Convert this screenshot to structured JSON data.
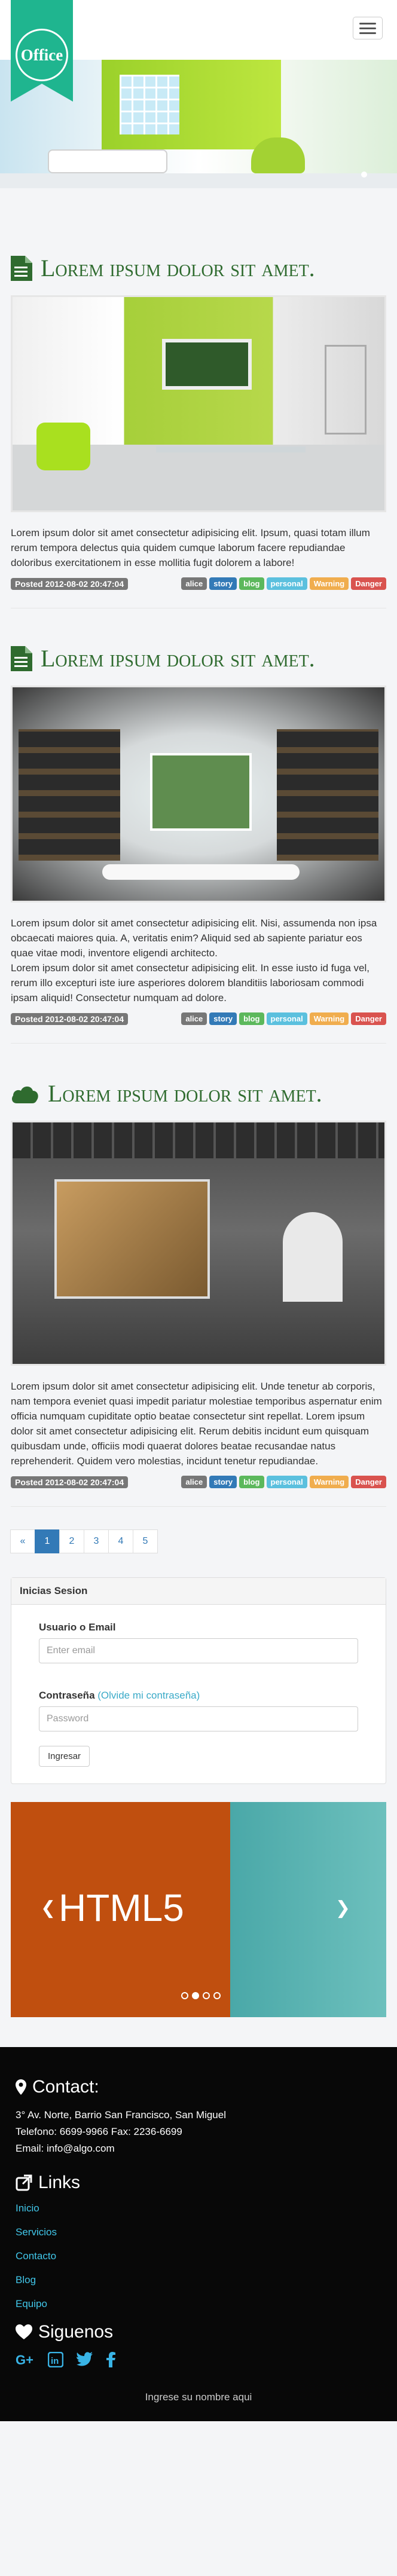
{
  "header": {
    "logo": "Office",
    "menu_icon": "hamburger-icon"
  },
  "posts": [
    {
      "title": "Lorem ipsum dolor sit amet.",
      "icon": "document-icon",
      "text": "Lorem ipsum dolor sit amet consectetur adipisicing elit. Ipsum, quasi totam illum rerum tempora delectus quia quidem cumque laborum facere repudiandae doloribus exercitationem in esse mollitia fugit dolorem a labore!",
      "date": "Posted 2012-08-02 20:47:04"
    },
    {
      "title": "Lorem ipsum dolor sit amet.",
      "icon": "document-icon",
      "text": "Lorem ipsum dolor sit amet consectetur adipisicing elit. Nisi, assumenda non ipsa obcaecati maiores quia. A, veritatis enim? Aliquid sed ab sapiente pariatur eos quae vitae modi, inventore eligendi architecto.\nLorem ipsum dolor sit amet consectetur adipisicing elit. In esse iusto id fuga vel, rerum illo excepturi iste iure asperiores dolorem blanditiis laboriosam commodi ipsam aliquid! Consectetur numquam ad dolore.",
      "date": "Posted 2012-08-02 20:47:04"
    },
    {
      "title": "Lorem ipsum dolor sit amet.",
      "icon": "cloud-icon",
      "text": "Lorem ipsum dolor sit amet consectetur adipisicing elit. Unde tenetur ab corporis, nam tempora eveniet quasi impedit pariatur molestiae temporibus aspernatur enim officia numquam cupiditate optio beatae consectetur sint repellat. Lorem ipsum dolor sit amet consectetur adipisicing elit. Rerum debitis incidunt eum quisquam quibusdam unde, officiis modi quaerat dolores beatae recusandae natus reprehenderit. Quidem vero molestias, incidunt tenetur repudiandae.",
      "date": "Posted 2012-08-02 20:47:04"
    }
  ],
  "tags": [
    "alice",
    "story",
    "blog",
    "personal",
    "Warning",
    "Danger"
  ],
  "pagination": [
    "«",
    "1",
    "2",
    "3",
    "4",
    "5"
  ],
  "login": {
    "title": "Inicias Sesion",
    "user_label": "Usuario o Email",
    "user_placeholder": "Enter email",
    "password_label": "Contraseña",
    "forgot": "(Olvide mi contraseña)",
    "password_placeholder": "Password",
    "submit": "Ingresar"
  },
  "slider": {
    "label": "HTML5"
  },
  "footer": {
    "contact_title": "Contact:",
    "address": "3° Av. Norte, Barrio San Francisco, San Miguel",
    "phone": "Telefono: 6699-9966 Fax: 2236-6699",
    "email": "Email: info@algo.com",
    "links_title": "Links",
    "links": [
      "Inicio",
      "Servicios",
      "Contacto",
      "Blog",
      "Equipo"
    ],
    "follow_title": "Siguenos",
    "copy": "Ingrese su nombre aqui"
  }
}
